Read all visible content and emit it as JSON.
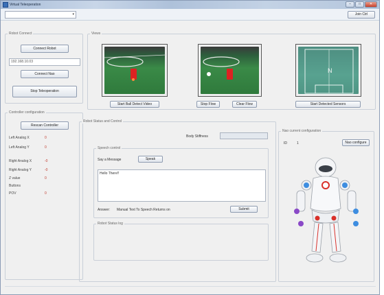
{
  "window": {
    "title": "Virtual Teleoperation",
    "minimize": "–",
    "maximize": "□",
    "close": "✕"
  },
  "toolbar": {
    "robot_select_value": "",
    "join_label": "Join Ctrl"
  },
  "robot_connection": {
    "label": "Robot Connect",
    "connect_label": "Connect Robot",
    "ip_value": "192.168.10.03",
    "connect_nao_label": "Connect Nao",
    "stop_label": "Stop Teleoperation"
  },
  "controller": {
    "label": "Controller configuration",
    "rescan_label": "Rescan Controller",
    "rows": [
      {
        "label": "Left Analog X",
        "value": "0"
      },
      {
        "label": "Left Analog Y",
        "value": "0"
      },
      {
        "label": "Right Analog X",
        "value": "-0"
      },
      {
        "label": "Right Analog Y",
        "value": "-0"
      },
      {
        "label": "Z value",
        "value": "0"
      },
      {
        "label": "Buttons",
        "value": ""
      },
      {
        "label": "POV",
        "value": "0"
      }
    ]
  },
  "views": {
    "label": "Views",
    "start_ball_detect_label": "Start Ball Detect Video",
    "stop_flow_label": "Stop Flow",
    "clear_flow_label": "Clear Flow",
    "start_joint_label": "Start Detected Sensors"
  },
  "robot_status": {
    "label": "Robot Status and Control",
    "body_stiffness_label": "Body Stiffness",
    "body_stiffness_value": "",
    "speech": {
      "label": "Speech control",
      "say_label": "Say a Message",
      "speak_label": "Speak",
      "message_text": "Hello There!!",
      "answer_label": "Answer:",
      "answer_value": "Manual Text To Speech Returns on",
      "submit_label": "Submit"
    },
    "status_label": "Robot Status log"
  },
  "nao": {
    "label": "Nao current configuration",
    "id_label": "ID",
    "id_value": "1",
    "configure_label": "Nao configure",
    "colors": {
      "red": "#d9302a",
      "blue": "#3d8de0",
      "purple": "#8a49c7",
      "grey": "#9aa0a8"
    }
  }
}
